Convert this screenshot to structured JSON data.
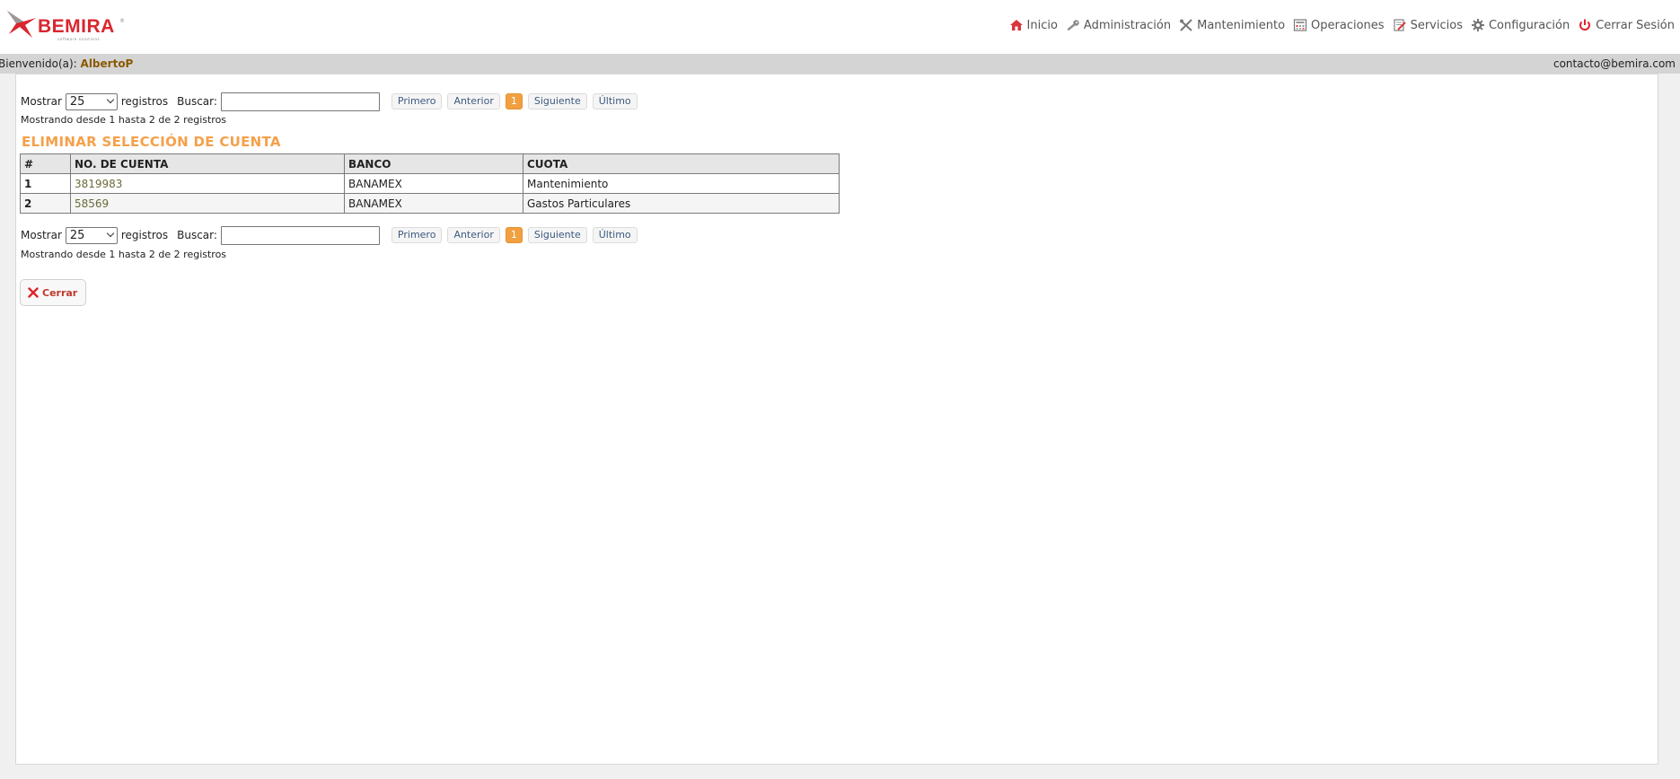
{
  "brand": {
    "name": "BEMIRA",
    "tagline": "software solutions",
    "registered": "®",
    "accent": "#d9262f"
  },
  "nav": [
    {
      "label": "Inicio",
      "icon": "home-icon"
    },
    {
      "label": "Administración",
      "icon": "key-icon"
    },
    {
      "label": "Mantenimiento",
      "icon": "tools-icon"
    },
    {
      "label": "Operaciones",
      "icon": "calculator-icon"
    },
    {
      "label": "Servicios",
      "icon": "services-icon"
    },
    {
      "label": "Configuración",
      "icon": "gear-icon"
    },
    {
      "label": "Cerrar Sesión",
      "icon": "power-icon"
    }
  ],
  "welcome": {
    "prefix": "Bienvenido(a):",
    "user": "AlbertoP",
    "contact": "contacto@bemira.com"
  },
  "list_controls": {
    "show_label": "Mostrar",
    "page_size": "25",
    "records_label": "registros",
    "search_label": "Buscar:",
    "search_value": "",
    "pager": {
      "first": "Primero",
      "prev": "Anterior",
      "current": "1",
      "next": "Siguiente",
      "last": "Último"
    },
    "info": "Mostrando desde 1 hasta 2 de 2 registros"
  },
  "section_title": "ELIMINAR SELECCIÓN DE CUENTA",
  "table": {
    "headers": [
      "#",
      "NO. DE CUENTA",
      "BANCO",
      "CUOTA"
    ],
    "rows": [
      {
        "num": "1",
        "account": "3819983",
        "bank": "BANAMEX",
        "fee": "Mantenimiento"
      },
      {
        "num": "2",
        "account": "58569",
        "bank": "BANAMEX",
        "fee": "Gastos Particulares"
      }
    ]
  },
  "close_label": "Cerrar"
}
